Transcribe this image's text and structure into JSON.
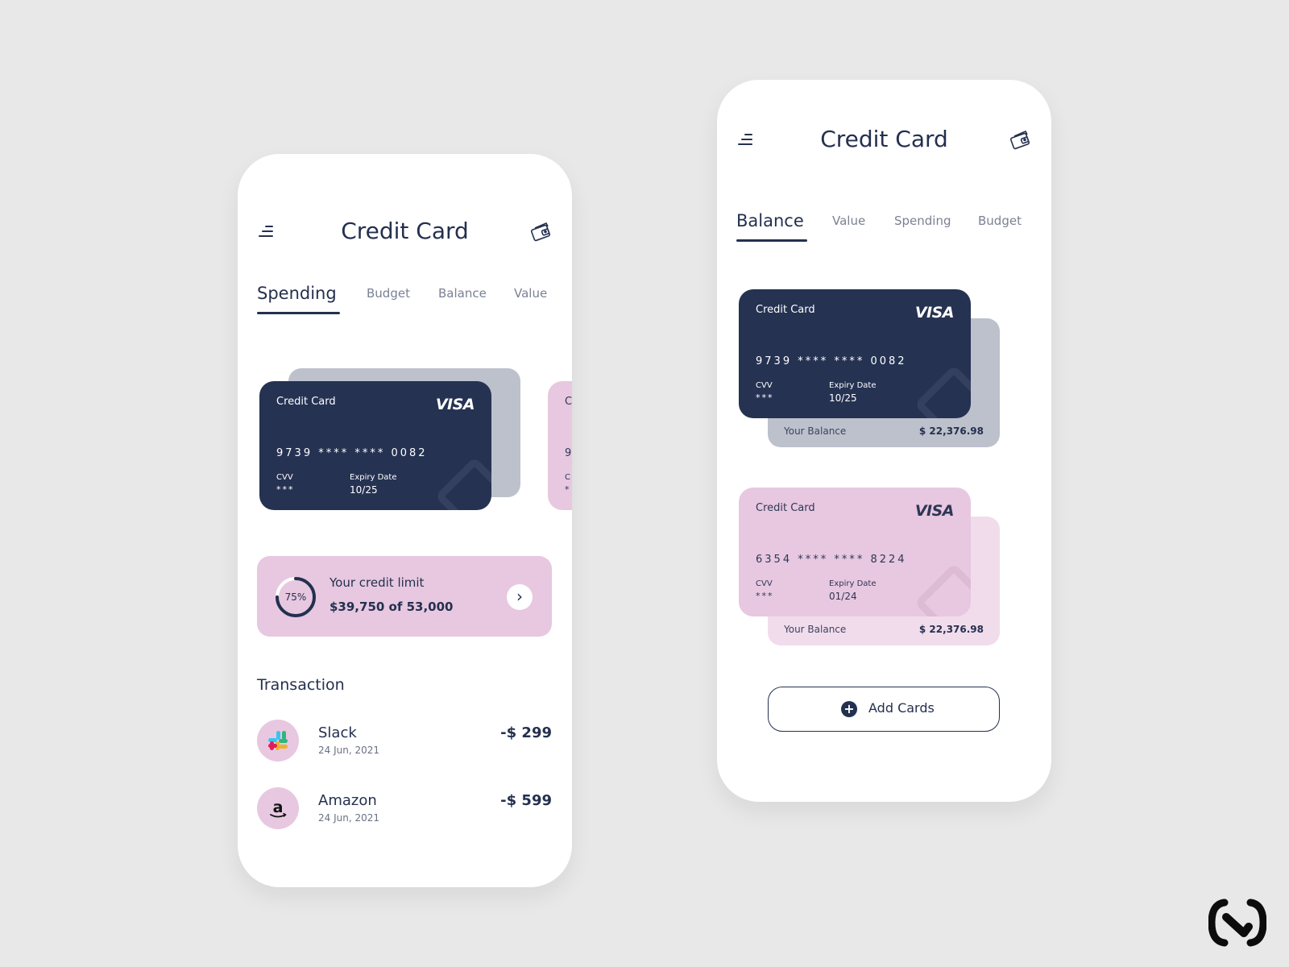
{
  "screen1": {
    "title": "Credit Card",
    "tabs": [
      {
        "label": "Spending",
        "active": true
      },
      {
        "label": "Budget",
        "active": false
      },
      {
        "label": "Balance",
        "active": false
      },
      {
        "label": "Value",
        "active": false
      }
    ],
    "card": {
      "label": "Credit Card",
      "brand": "VISA",
      "number": "9739 **** **** 0082",
      "cvv_label": "CVV",
      "cvv": "***",
      "expiry_label": "Expiry Date",
      "expiry": "10/25"
    },
    "peek_card": {
      "label": "C",
      "number": "9",
      "cvv_label": "C",
      "cvv": "*"
    },
    "credit_limit": {
      "percent": 75,
      "percent_text": "75%",
      "title": "Your credit limit",
      "amount": "$39,750 of 53,000",
      "arrow": "›"
    },
    "transaction_title": "Transaction",
    "transactions": [
      {
        "name": "Slack",
        "date": "24 Jun, 2021",
        "amount": "-$ 299",
        "icon": "slack-logo-icon"
      },
      {
        "name": "Amazon",
        "date": "24 Jun, 2021",
        "amount": "-$ 599",
        "icon": "amazon-logo-icon"
      }
    ]
  },
  "screen2": {
    "title": "Credit Card",
    "tabs": [
      {
        "label": "Balance",
        "active": true
      },
      {
        "label": "Value",
        "active": false
      },
      {
        "label": "Spending",
        "active": false
      },
      {
        "label": "Budget",
        "active": false
      }
    ],
    "cards": [
      {
        "label": "Credit Card",
        "brand": "VISA",
        "number": "9739 **** **** 0082",
        "cvv_label": "CVV",
        "cvv": "***",
        "expiry_label": "Expiry Date",
        "expiry": "10/25",
        "balance_label": "Your Balance",
        "balance": "$ 22,376.98"
      },
      {
        "label": "Credit Card",
        "brand": "VISA",
        "number": "6354 **** **** 8224",
        "cvv_label": "CVV",
        "cvv": "***",
        "expiry_label": "Expiry Date",
        "expiry": "01/24",
        "balance_label": "Your Balance",
        "balance": "$ 22,376.98"
      }
    ],
    "add_button": {
      "plus": "+",
      "label": "Add Cards"
    }
  },
  "colors": {
    "background": "#e8e8e8",
    "navy": "#253252",
    "pink": "#e7c8e0",
    "light_pink": "#f1dcec",
    "grey_card": "#bcc1cc",
    "text_muted": "#7b8194"
  },
  "icons": [
    "menu-icon",
    "wallet-icon",
    "chevron-right-icon",
    "plus-circle-icon",
    "brand-logo-icon"
  ]
}
